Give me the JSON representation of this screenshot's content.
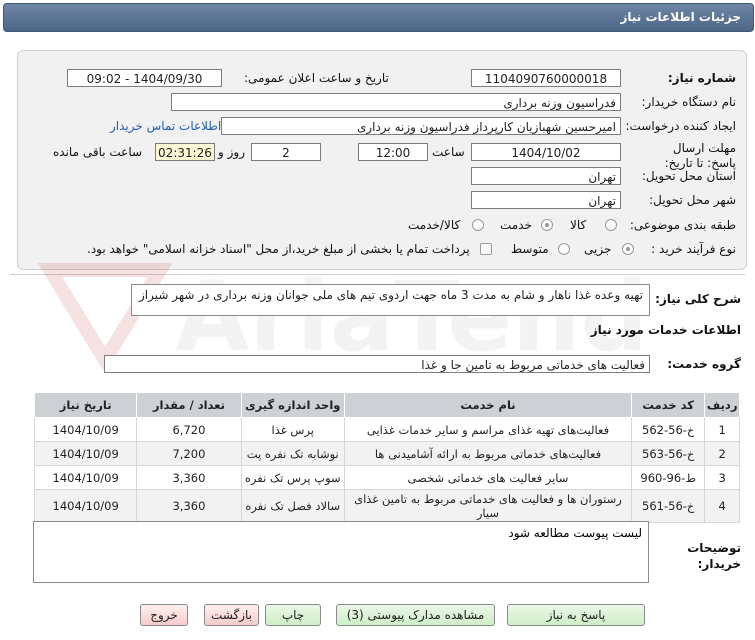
{
  "title": "جزئیات اطلاعات نیاز",
  "form": {
    "need_number_label": "شماره نیاز:",
    "need_number": "1104090760000018",
    "announce_label": "تاریخ و ساعت اعلان عمومی:",
    "announce_value": "1404/09/30 - 09:02",
    "buyer_org_label": "نام دستگاه خریدار:",
    "buyer_org": "فدراسیون وزنه برداری",
    "requester_label": "ایجاد کننده درخواست:",
    "requester": "امیرحسین شهبازیان کارپرداز فدراسیون وزنه برداری",
    "contact_link": "اطلاعات تماس خریدار",
    "deadline_label": "مهلت ارسال پاسخ: تا تاریخ:",
    "deadline_date": "1404/10/02",
    "time_label": "ساعت",
    "deadline_time": "12:00",
    "days_value": "2",
    "days_label": "روز و",
    "remaining_time": "02:31:26",
    "remaining_label": "ساعت باقی مانده",
    "province_label": "استان محل تحویل:",
    "province": "تهران",
    "city_label": "شهر محل تحویل:",
    "city": "تهران",
    "category_label": "طبقه بندی موضوعی:",
    "category_options": [
      "کالا",
      "خدمت",
      "کالا/خدمت"
    ],
    "category_selected": "خدمت",
    "process_label": "نوع فرآیند خرید :",
    "process_options": [
      "جزیی",
      "متوسط"
    ],
    "process_selected": "جزیی",
    "treasury_note": "پرداخت تمام یا بخشی از مبلغ خرید،از محل \"اسناد خزانه اسلامی\" خواهد بود."
  },
  "description": {
    "label": "شرح کلی نیاز:",
    "text": "تهیه وعده غذا ناهار و شام به مدت 3 ماه جهت اردوی تیم های ملی جوانان وزنه برداری در شهر شیراز"
  },
  "services": {
    "section_title": "اطلاعات خدمات مورد نیاز",
    "group_label": "گروه خدمت:",
    "group_value": "فعالیت های خدماتی مربوط به تامین جا و غذا",
    "columns": [
      "ردیف",
      "کد خدمت",
      "نام خدمت",
      "واحد اندازه گیری",
      "تعداد / مقدار",
      "تاریخ نیاز"
    ],
    "rows": [
      [
        "1",
        "خ-56-562",
        "فعالیت‌های تهیه غذای مراسم و سایر خدمات غذایی",
        "پرس غذا",
        "6,720",
        "1404/10/09"
      ],
      [
        "2",
        "خ-56-563",
        "فعالیت‌های خدماتی مربوط به ارائه آشامیدنی ها",
        "نوشابه تک نفره پت",
        "7,200",
        "1404/10/09"
      ],
      [
        "3",
        "ط-96-960",
        "سایر فعالیت های خدماتی شخصی",
        "سوپ پرس تک نفره",
        "3,360",
        "1404/10/09"
      ],
      [
        "4",
        "خ-56-561",
        "رستوران ها و فعالیت های خدماتی مربوط به تامین غذای سیار",
        "سالاد فصل تک نفره",
        "3,360",
        "1404/10/09"
      ]
    ]
  },
  "notes": {
    "label": "توضیحات خریدار:",
    "text": "لیست پیوست مطالعه شود"
  },
  "buttons": {
    "reply": "پاسخ به نیاز",
    "attachments": "مشاهده مدارک پیوستی (3)",
    "print": "چاپ",
    "back": "بازگشت",
    "exit": "خروج"
  },
  "watermark_text": "AriaTender.net",
  "colors": {
    "title_bar": "#5a7292",
    "link": "#1f5fb8",
    "highlight_yellow": "#fdf7d6",
    "button_green": "#cfeec8",
    "button_red": "#f7caca"
  }
}
